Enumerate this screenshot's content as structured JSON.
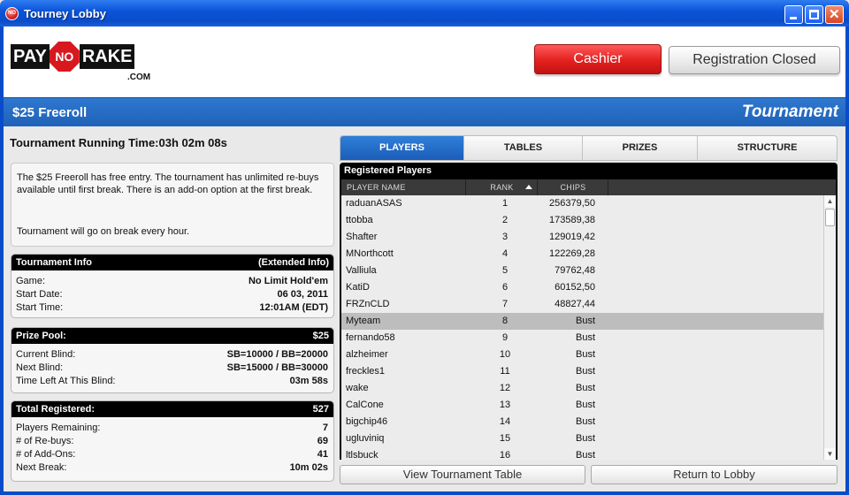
{
  "window": {
    "title": "Tourney Lobby",
    "icon": "app-logo-icon"
  },
  "logo": {
    "part1": "PAY",
    "part2": "NO",
    "part3": "RAKE",
    "suffix": ".COM"
  },
  "header": {
    "cashier_label": "Cashier",
    "registration_label": "Registration Closed"
  },
  "banner": {
    "tournament_name": "$25 Freeroll",
    "type_label": "Tournament"
  },
  "running_time": {
    "label": "Tournament Running Time:",
    "value": "03h 02m 08s"
  },
  "description": {
    "line1": "The $25 Freeroll has free entry.  The tournament has unlimited re-buys available until first break.  There is an add-on option at the first break.",
    "line2": "Tournament will go on break every hour."
  },
  "tournament_info": {
    "title": "Tournament Info",
    "extended_label": "(Extended Info)",
    "rows": [
      {
        "key": "Game:",
        "value": "No Limit Hold'em"
      },
      {
        "key": "Start Date:",
        "value": "06 03, 2011"
      },
      {
        "key": "Start Time:",
        "value": "12:01AM (EDT)"
      }
    ]
  },
  "prize_pool": {
    "title": "Prize Pool:",
    "value": "$25",
    "rows": [
      {
        "key": "Current Blind:",
        "value": "SB=10000 / BB=20000"
      },
      {
        "key": "Next Blind:",
        "value": "SB=15000 / BB=30000"
      },
      {
        "key": "Time Left At This Blind:",
        "value": "03m 58s"
      }
    ]
  },
  "registered": {
    "title": "Total Registered:",
    "value": "527",
    "rows": [
      {
        "key": "Players Remaining:",
        "value": "7"
      },
      {
        "key": "# of Re-buys:",
        "value": "69"
      },
      {
        "key": "# of Add-Ons:",
        "value": "41"
      },
      {
        "key": "Next Break:",
        "value": "10m 02s"
      }
    ]
  },
  "tabs": [
    "PLAYERS",
    "TABLES",
    "PRIZES",
    "STRUCTURE"
  ],
  "players_list": {
    "title": "Registered Players",
    "columns": [
      "PLAYER NAME",
      "RANK",
      "CHIPS"
    ],
    "rows": [
      {
        "name": "raduanASAS",
        "rank": "1",
        "chips": "256379,50"
      },
      {
        "name": "ttobba",
        "rank": "2",
        "chips": "173589,38"
      },
      {
        "name": "Shafter",
        "rank": "3",
        "chips": "129019,42"
      },
      {
        "name": "MNorthcott",
        "rank": "4",
        "chips": "122269,28"
      },
      {
        "name": "Valliula",
        "rank": "5",
        "chips": "79762,48"
      },
      {
        "name": "KatiD",
        "rank": "6",
        "chips": "60152,50"
      },
      {
        "name": "FRZnCLD",
        "rank": "7",
        "chips": "48827,44"
      },
      {
        "name": "Myteam",
        "rank": "8",
        "chips": "Bust"
      },
      {
        "name": "fernando58",
        "rank": "9",
        "chips": "Bust"
      },
      {
        "name": "alzheimer",
        "rank": "10",
        "chips": "Bust"
      },
      {
        "name": "freckles1",
        "rank": "11",
        "chips": "Bust"
      },
      {
        "name": "wake",
        "rank": "12",
        "chips": "Bust"
      },
      {
        "name": "CalCone",
        "rank": "13",
        "chips": "Bust"
      },
      {
        "name": "bigchip46",
        "rank": "14",
        "chips": "Bust"
      },
      {
        "name": "ugluviniq",
        "rank": "15",
        "chips": "Bust"
      },
      {
        "name": "ltlsbuck",
        "rank": "16",
        "chips": "Bust"
      }
    ]
  },
  "footer": {
    "view_table_label": "View Tournament Table",
    "return_label": "Return to Lobby"
  }
}
